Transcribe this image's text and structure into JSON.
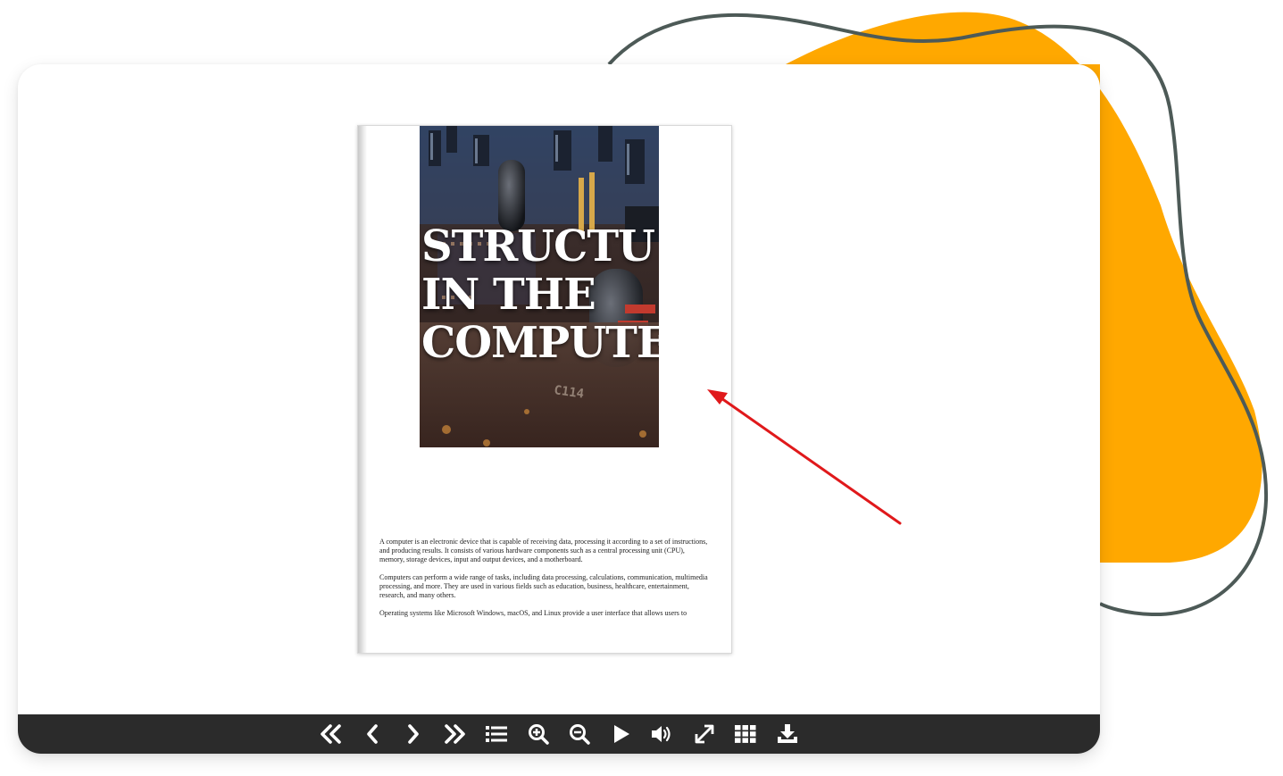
{
  "book": {
    "cover": {
      "title_lines": [
        "STRUCTU",
        "IN THE",
        "COMPUTE"
      ]
    },
    "paragraphs": [
      "A computer is an electronic device that is capable of receiving data, processing it according to a set of instructions, and producing results. It consists of various hardware components such as a central processing unit (CPU), memory, storage devices, input and output devices, and a motherboard.",
      "Computers can perform a wide range of tasks, including data processing, calculations, communication, multimedia processing, and more. They are used in various fields such as education, business, healthcare, entertainment, research, and many others.",
      "Operating systems like Microsoft Windows, macOS, and Linux provide a user interface that allows users to"
    ]
  },
  "toolbar": {
    "buttons": [
      {
        "icon": "first-page-icon"
      },
      {
        "icon": "previous-page-icon"
      },
      {
        "icon": "next-page-icon"
      },
      {
        "icon": "last-page-icon"
      },
      {
        "icon": "table-of-contents-icon"
      },
      {
        "icon": "zoom-in-icon"
      },
      {
        "icon": "zoom-out-icon"
      },
      {
        "icon": "autoplay-icon"
      },
      {
        "icon": "sound-icon"
      },
      {
        "icon": "fullscreen-icon"
      },
      {
        "icon": "thumbnails-icon"
      },
      {
        "icon": "download-icon"
      }
    ]
  },
  "colors": {
    "accent_blob": "#FFA800",
    "outline_curve": "#4D5A57",
    "arrow": "#E0191B",
    "toolbar_bg": "#2B2B2B",
    "toolbar_icon": "#FFFFFF"
  }
}
